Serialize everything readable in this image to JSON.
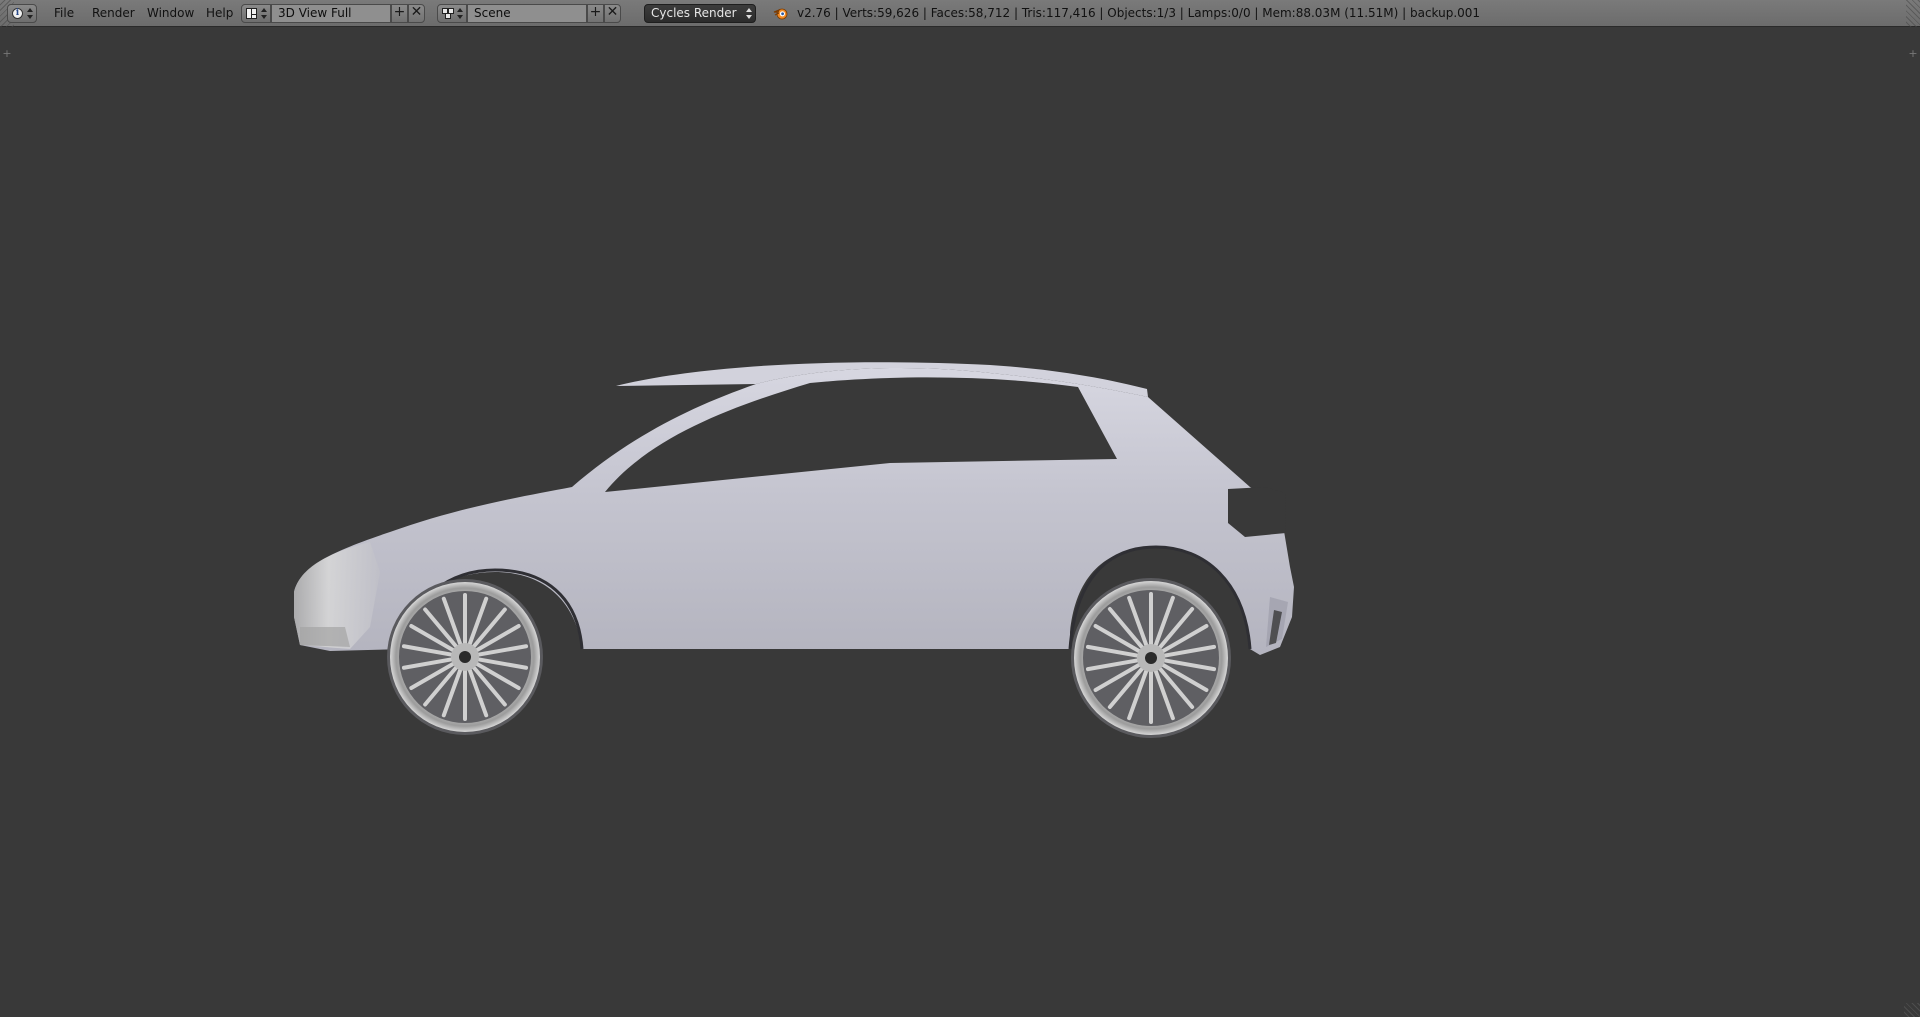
{
  "header": {
    "editor_type_icon": "info-icon",
    "menus": {
      "file": "File",
      "render": "Render",
      "window": "Window",
      "help": "Help"
    },
    "screen_layout": {
      "icon": "screen-layout-icon",
      "name": "3D View Full"
    },
    "scene": {
      "icon": "scene-icon",
      "name": "Scene"
    },
    "render_engine": "Cycles Render",
    "stats": "v2.76 | Verts:59,626 | Faces:58,712 | Tris:117,416 | Objects:1/3 | Lamps:0/0 | Mem:88.03M (11.51M) | backup.001"
  },
  "viewport": {
    "object": "car-model",
    "background_color": "#393939",
    "model_color": "#c9c9d3"
  }
}
